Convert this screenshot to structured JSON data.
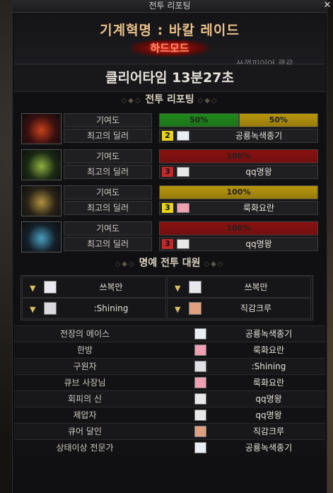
{
  "window": {
    "title": "전투 리포팅",
    "close_icon": "close-icon"
  },
  "header": {
    "dungeon": "기계혁명 : 바칼 레이드",
    "mode": "하드모드",
    "overlay": "쓰껏피이어 클로"
  },
  "clear_time": "클리어타임  13분27초",
  "report_section": {
    "title": "전투 리포팅",
    "contribution_label": "기여도",
    "top_dealer_label": "최고의 딜러"
  },
  "parties": [
    {
      "portrait_icon": "fire-emblem-icon",
      "contribution": [
        {
          "label": "50%",
          "value": 50,
          "color": "#1f8a1a"
        },
        {
          "label": "50%",
          "value": 50,
          "color": "#b8960c"
        }
      ],
      "rank": "2",
      "rank_color": "#e6d21a",
      "dealer": "공룡녹색종기"
    },
    {
      "portrait_icon": "green-emblem-icon",
      "contribution": [
        {
          "label": "100%",
          "value": 100,
          "color": "#8a1010"
        }
      ],
      "rank": "3",
      "rank_color": "#c22a2a",
      "dealer": "qq명왕"
    },
    {
      "portrait_icon": "gold-emblem-icon",
      "contribution": [
        {
          "label": "100%",
          "value": 100,
          "color": "#b8960c"
        }
      ],
      "rank": "3",
      "rank_color": "#e6d21a",
      "dealer": "룩화요란"
    },
    {
      "portrait_icon": "blue-emblem-icon",
      "contribution": [
        {
          "label": "100%",
          "value": 100,
          "color": "#8a1010"
        }
      ],
      "rank": "3",
      "rank_color": "#c22a2a",
      "dealer": "qq명왕"
    }
  ],
  "honor_section": {
    "title": "명예 전투 대원"
  },
  "honor_members": [
    "쓰복만",
    "쓰복만",
    ":Shining",
    "직감크루"
  ],
  "awards": [
    {
      "title": "전장의 에이스",
      "name": "공룡녹색종기"
    },
    {
      "title": "한방",
      "name": "룩화요란"
    },
    {
      "title": "구원자",
      "name": ":Shining"
    },
    {
      "title": "큐브 사장님",
      "name": "룩화요란"
    },
    {
      "title": "회피의 신",
      "name": "qq명왕"
    },
    {
      "title": "제압자",
      "name": "qq명왕"
    },
    {
      "title": "큐어 달인",
      "name": "직감크루"
    },
    {
      "title": "상태이상 전문가",
      "name": "공룡녹색종기"
    }
  ]
}
